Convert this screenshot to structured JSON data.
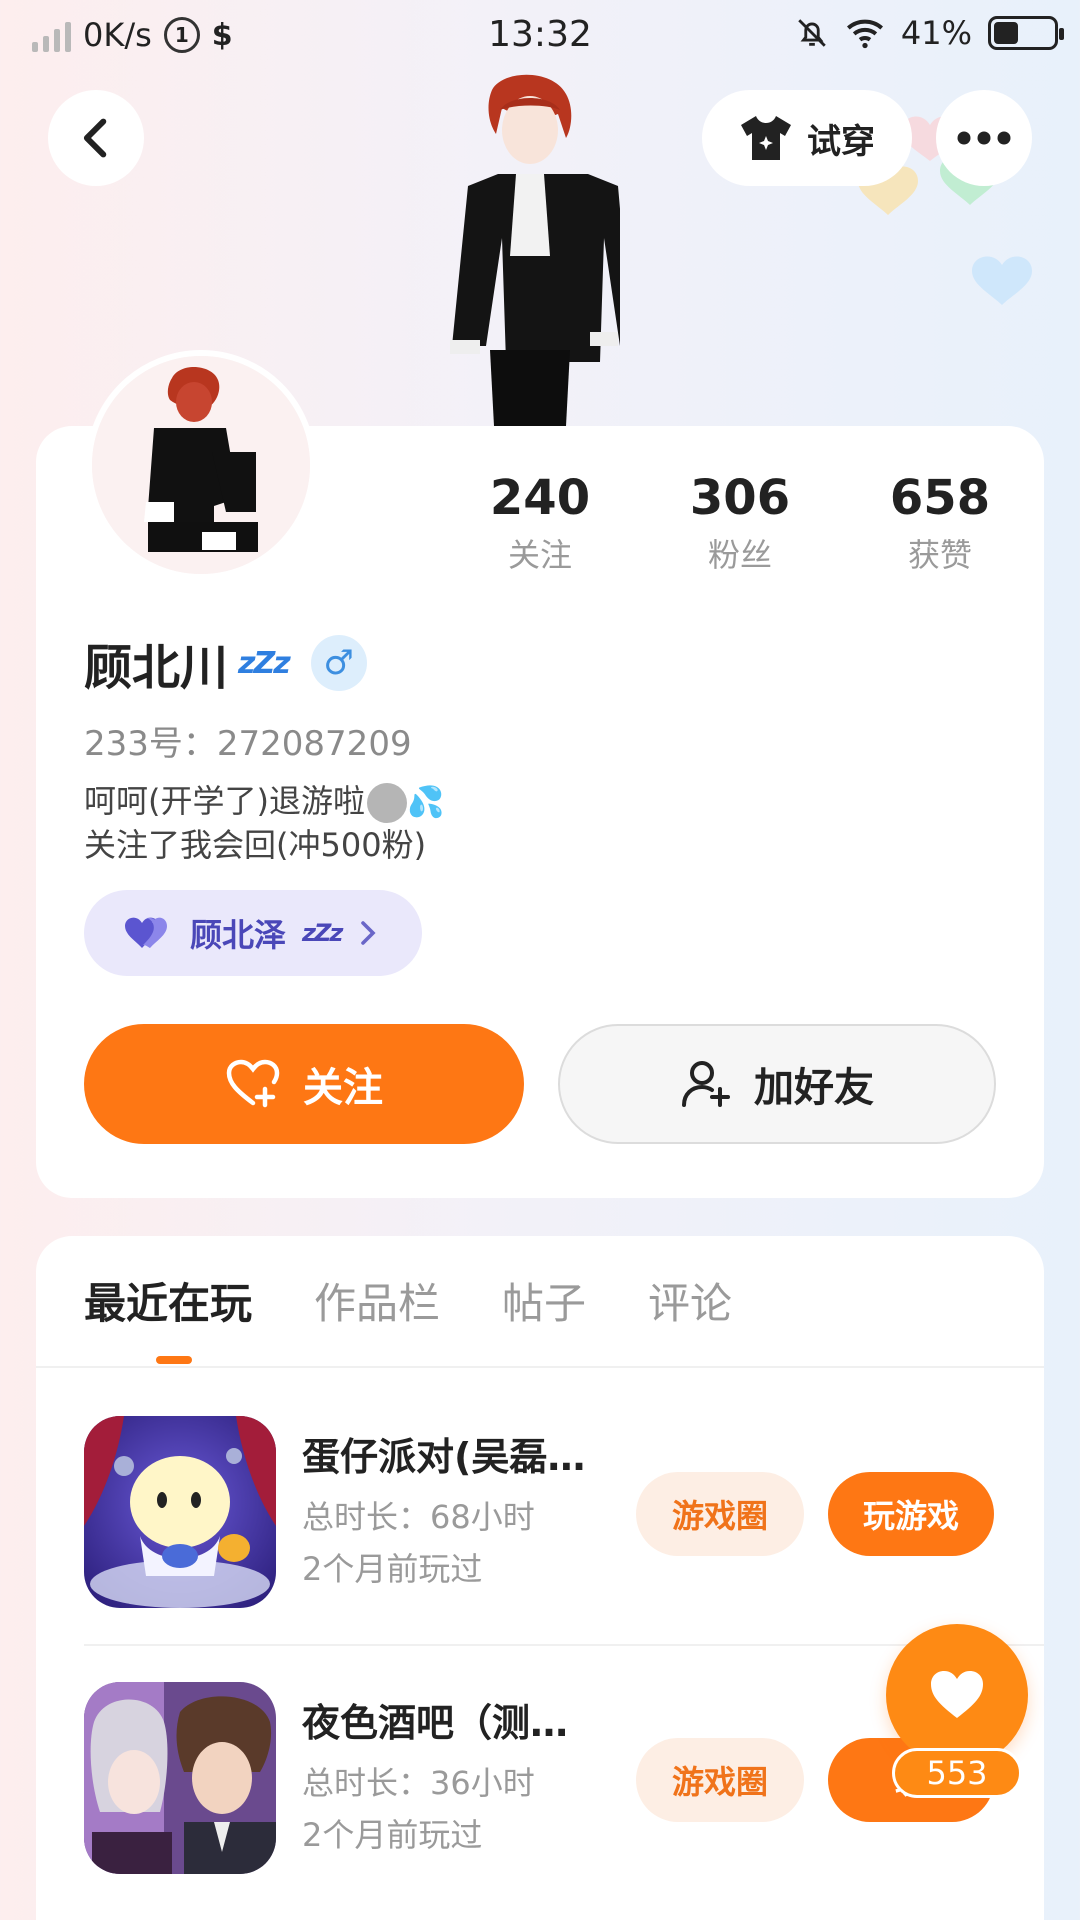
{
  "status_bar": {
    "network_speed": "0K/s",
    "time": "13:32",
    "battery_pct": "41%",
    "battery_level": 0.41
  },
  "header": {
    "tryon_label": "试穿"
  },
  "profile": {
    "name": "顾北川",
    "name_suffix": "zZz",
    "gender_symbol": "♂",
    "uid": "233号：272087209",
    "bio_line1": "呵呵(开学了)退游啦",
    "bio_line2": "关注了我会回(冲500粉)",
    "stats": [
      {
        "value": "240",
        "label": "关注"
      },
      {
        "value": "306",
        "label": "粉丝"
      },
      {
        "value": "658",
        "label": "获赞"
      }
    ],
    "cp": {
      "name": "顾北泽",
      "suffix": "zZz"
    }
  },
  "actions": {
    "follow": "关注",
    "add_friend": "加好友"
  },
  "tabs": [
    "最近在玩",
    "作品栏",
    "帖子",
    "评论"
  ],
  "games": [
    {
      "title": "蛋仔派对(吴磊…",
      "duration": "总时长：68小时",
      "last_played": "2个月前玩过",
      "circle_label": "游戏圈",
      "play_label": "玩游戏"
    },
    {
      "title": "夜色酒吧（测…",
      "duration": "总时长：36小时",
      "last_played": "2个月前玩过",
      "circle_label": "游戏圈",
      "play_label": "玩"
    }
  ],
  "like_count": "553",
  "colors": {
    "accent": "#fe7714",
    "cp_bg": "#eae8fb",
    "gender": "#3d8fe0"
  }
}
